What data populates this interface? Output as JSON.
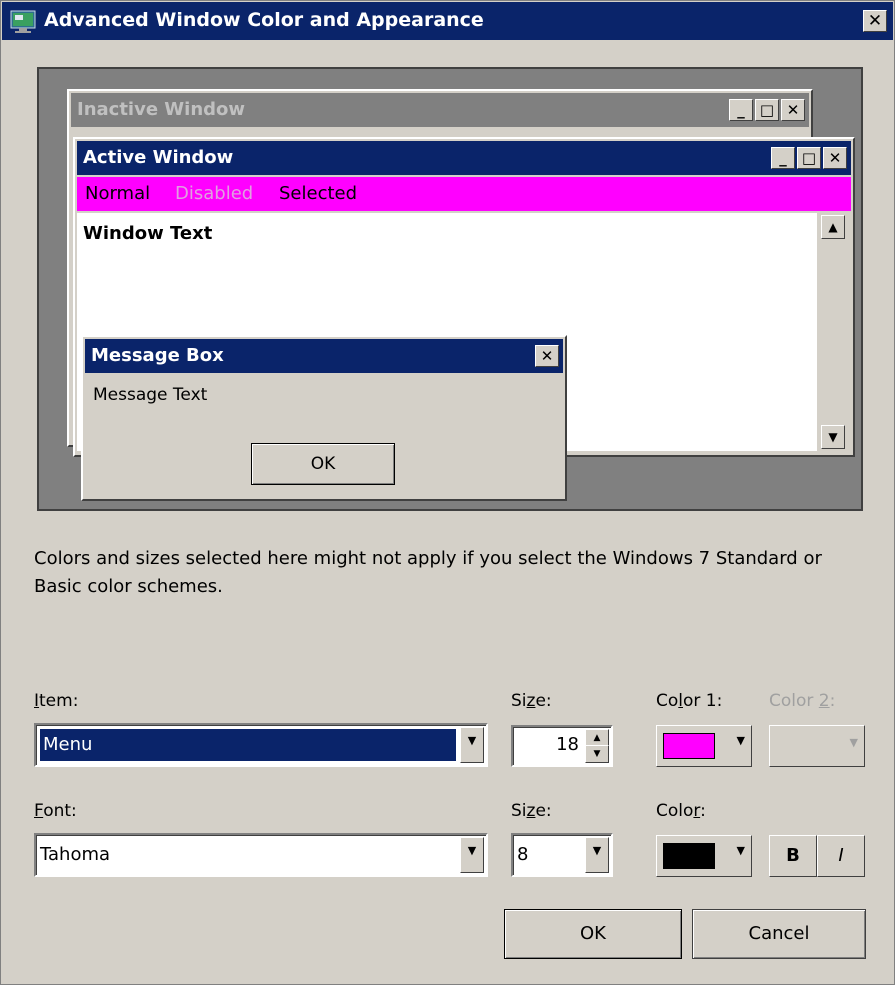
{
  "window": {
    "title": "Advanced Window Color and Appearance",
    "close_glyph": "✕"
  },
  "preview": {
    "inactive_window": {
      "title": "Inactive Window"
    },
    "active_window": {
      "title": "Active Window"
    },
    "menu": {
      "normal": "Normal",
      "disabled": "Disabled",
      "selected": "Selected"
    },
    "window_text": "Window Text",
    "message_box": {
      "title": "Message Box",
      "text": "Message Text",
      "ok_label": "OK"
    }
  },
  "note": "Colors and sizes selected here might not apply if you select the Windows 7 Standard or Basic color schemes.",
  "item_row": {
    "item_label": "Item:",
    "item_value": "Menu",
    "size_label": "Size:",
    "size_value": "18",
    "color1_label": "Color 1:",
    "color1_value": "#ff00ff",
    "color2_label": "Color 2:"
  },
  "font_row": {
    "font_label": "Font:",
    "font_value": "Tahoma",
    "size_label": "Size:",
    "size_value": "8",
    "color_label": "Color:",
    "color_value": "#000000",
    "bold_label": "B",
    "italic_label": "I"
  },
  "buttons": {
    "ok": "OK",
    "cancel": "Cancel"
  },
  "colors": {
    "titlebar": "#0a246a",
    "menu_bg": "#ff00ff",
    "face": "#d4d0c8"
  },
  "icons": [
    "app-monitor-icon",
    "close-icon",
    "minimize-icon",
    "maximize-icon",
    "scroll-up-icon",
    "scroll-down-icon",
    "dropdown-arrow-icon",
    "spin-up-icon",
    "spin-down-icon"
  ]
}
